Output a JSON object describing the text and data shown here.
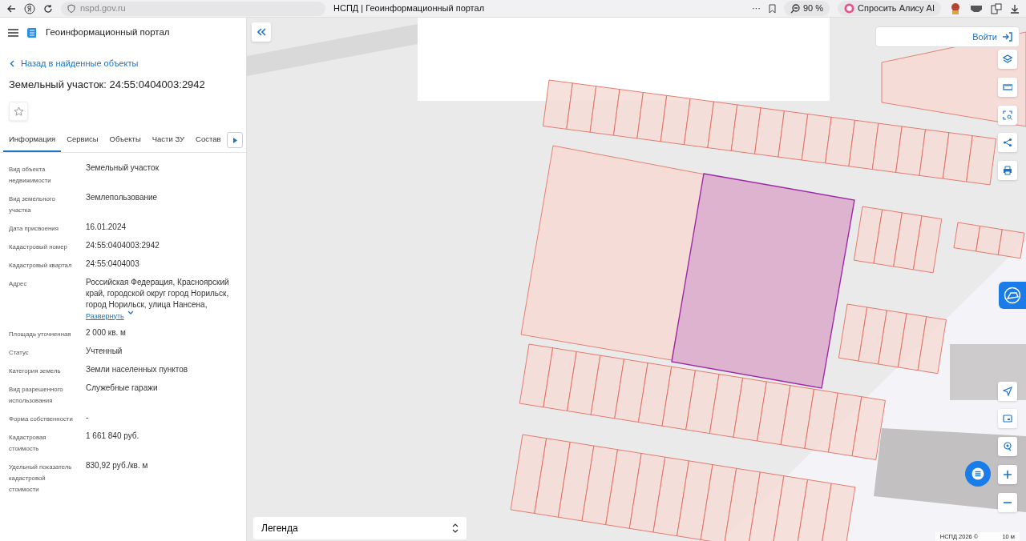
{
  "browser": {
    "url": "nspd.gov.ru",
    "title": "НСПД | Геоинформационный портал",
    "more": "···",
    "zoom": "90 %",
    "alice": "Спросить Алису AI"
  },
  "header": {
    "title": "Геоинформационный портал"
  },
  "back_link": "Назад в найденные объекты",
  "object_title": "Земельный участок: 24:55:0404003:2942",
  "favorite": false,
  "tabs": [
    {
      "label": "Информация",
      "selected": true
    },
    {
      "label": "Сервисы",
      "selected": false
    },
    {
      "label": "Объекты",
      "selected": false
    },
    {
      "label": "Части ЗУ",
      "selected": false
    },
    {
      "label": "Состав",
      "selected": false
    }
  ],
  "fields": [
    {
      "label": "Вид объекта недвижимости",
      "value": "Земельный участок"
    },
    {
      "label": "Вид земельного участка",
      "value": "Землепользование"
    },
    {
      "label": "Дата присвоения",
      "value": "16.01.2024"
    },
    {
      "label": "Кадастровый номер",
      "value": "24:55:0404003:2942"
    },
    {
      "label": "Кадастровый квартал",
      "value": "24:55:0404003"
    },
    {
      "label": "Адрес",
      "value": "Российская Федерация, Красноярский край, городской округ город Норильск, город Норильск, улица Нансена,",
      "expand": "Развернуть"
    },
    {
      "label": "Площадь уточненная",
      "value": "2 000 кв. м"
    },
    {
      "label": "Статус",
      "value": "Учтенный"
    },
    {
      "label": "Категория земель",
      "value": "Земли населенных пунктов"
    },
    {
      "label": "Вид разрешенного использования",
      "value": "Служебные гаражи"
    },
    {
      "label": "Форма собственности",
      "value": "-"
    },
    {
      "label": "Кадастровая стоимость",
      "value": "1 661 840 руб."
    },
    {
      "label": "Удельный показатель кадастровой стоимости",
      "value": "830,92 руб./кв. м"
    }
  ],
  "map": {
    "login": "Войти",
    "legend": "Легенда",
    "copyright": "НСПД 2026 ©",
    "scale": "10 м"
  }
}
